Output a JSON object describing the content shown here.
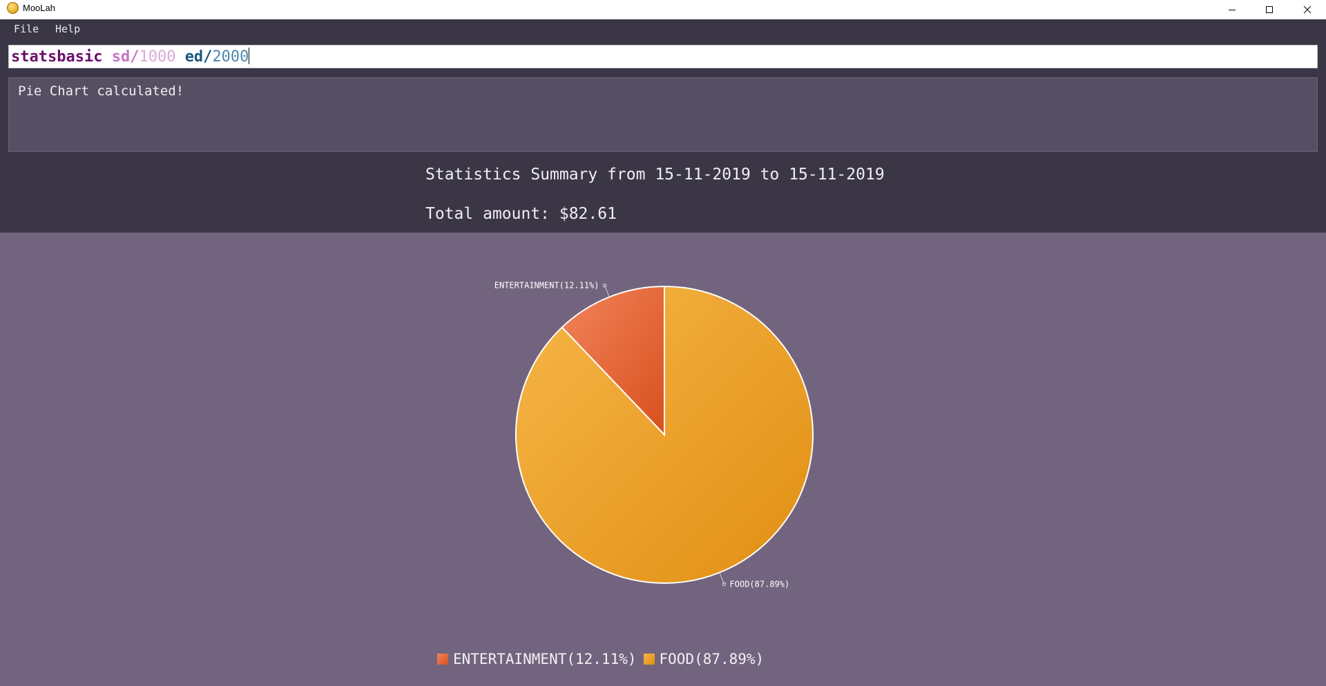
{
  "window": {
    "title": "MooLah",
    "icon": "moolah-coin-icon",
    "controls": [
      "minimize-icon",
      "maximize-icon",
      "close-icon"
    ]
  },
  "menu": {
    "items": [
      {
        "label": "File"
      },
      {
        "label": "Help"
      }
    ]
  },
  "command": {
    "keyword": "statsbasic",
    "prefix1": "sd/",
    "value1": "1000",
    "prefix2": "ed/",
    "value2": "2000"
  },
  "result": {
    "message": "Pie Chart calculated!"
  },
  "stats": {
    "title": "Statistics Summary from 15-11-2019 to 15-11-2019",
    "total": "Total amount: $82.61"
  },
  "chart_data": {
    "type": "pie",
    "title": "",
    "slices": [
      {
        "label": "ENTERTAINMENT(12.11%)",
        "name": "ENTERTAINMENT",
        "value": 12.11,
        "color": "#dc5a2a"
      },
      {
        "label": "FOOD(87.89%)",
        "name": "FOOD",
        "value": 87.89,
        "color": "#e89a22"
      }
    ],
    "legend": "bottom"
  }
}
